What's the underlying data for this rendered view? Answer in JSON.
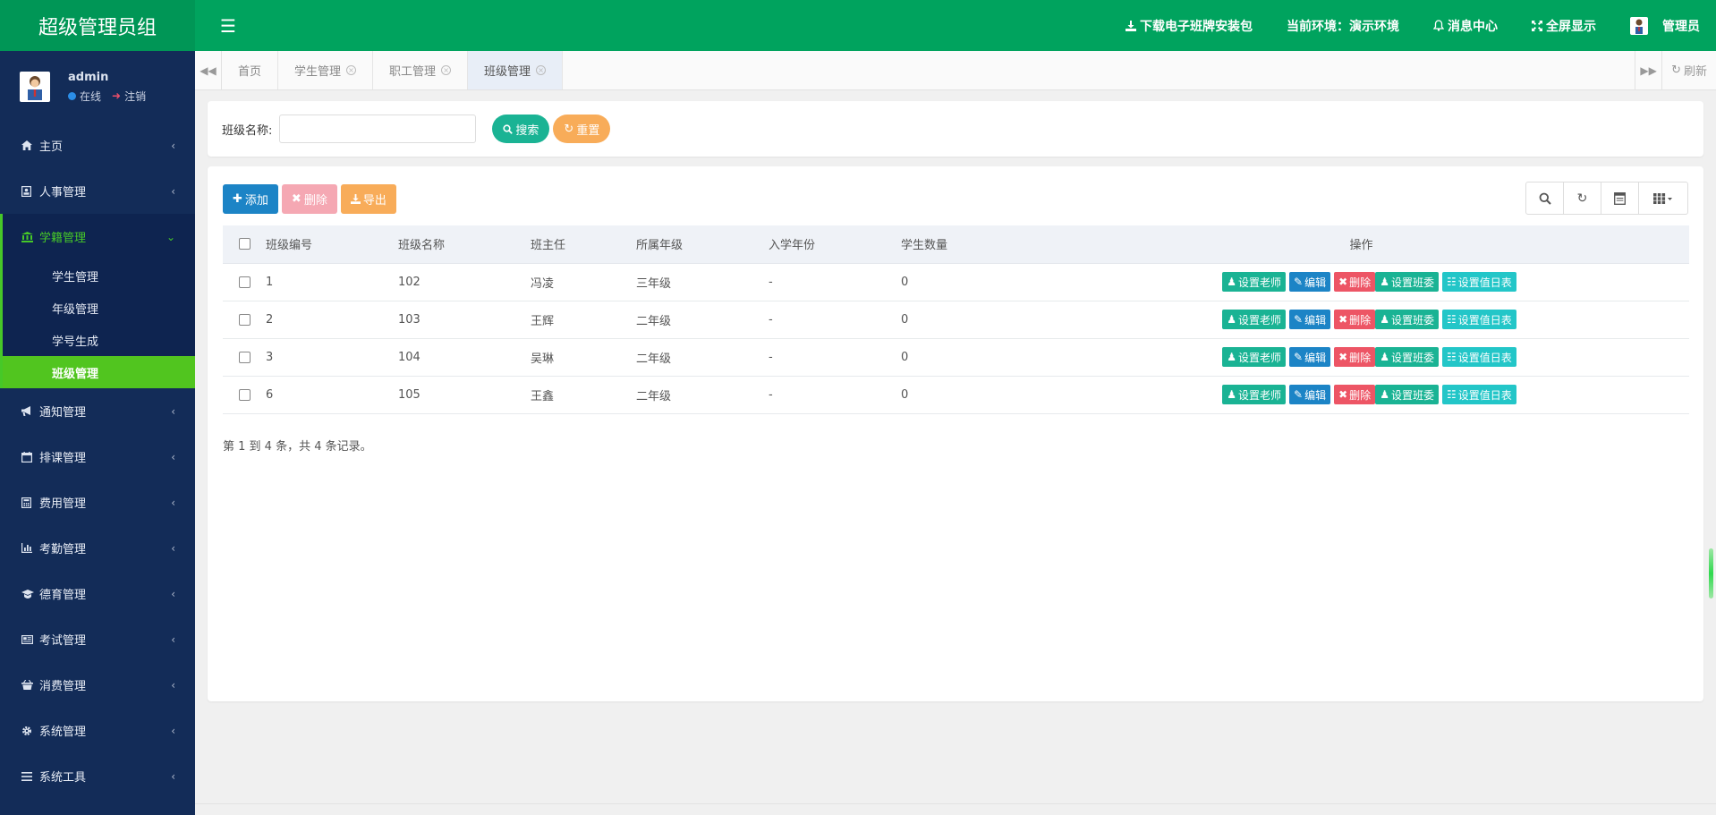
{
  "brand": {
    "title": "超级管理员组"
  },
  "topbar": {
    "download": "下载电子班牌安装包",
    "environment": "当前环境：演示环境",
    "messages": "消息中心",
    "fullscreen": "全屏显示",
    "admin": "管理员"
  },
  "user": {
    "name": "admin",
    "status": "在线",
    "logout": "注销"
  },
  "sidebar": {
    "items": [
      {
        "label": "主页",
        "icon": "home-icon"
      },
      {
        "label": "人事管理",
        "icon": "person-card-icon"
      },
      {
        "label": "学籍管理",
        "icon": "bank-icon",
        "active": true
      },
      {
        "label": "通知管理",
        "icon": "megaphone-icon"
      },
      {
        "label": "排课管理",
        "icon": "calendar-icon"
      },
      {
        "label": "费用管理",
        "icon": "calculator-icon"
      },
      {
        "label": "考勤管理",
        "icon": "bar-chart-icon"
      },
      {
        "label": "德育管理",
        "icon": "graduation-cap-icon"
      },
      {
        "label": "考试管理",
        "icon": "newspaper-icon"
      },
      {
        "label": "消费管理",
        "icon": "basket-icon"
      },
      {
        "label": "系统管理",
        "icon": "gear-icon"
      },
      {
        "label": "系统工具",
        "icon": "list-icon"
      }
    ],
    "submenu": [
      "学生管理",
      "年级管理",
      "学号生成",
      "班级管理"
    ]
  },
  "tabs": [
    {
      "label": "首页"
    },
    {
      "label": "学生管理"
    },
    {
      "label": "职工管理"
    },
    {
      "label": "班级管理",
      "active": true
    }
  ],
  "tabs_refresh": "刷新",
  "search": {
    "label": "班级名称:",
    "value": "",
    "placeholder": "",
    "search_btn": "搜索",
    "reset_btn": "重置"
  },
  "toolbar": {
    "add": "添加",
    "delete": "删除",
    "export": "导出"
  },
  "table": {
    "headers": [
      "班级编号",
      "班级名称",
      "班主任",
      "所属年级",
      "入学年份",
      "学生数量",
      "操作"
    ],
    "rows": [
      {
        "id": "1",
        "name": "102",
        "head": "冯凌",
        "grade": "三年级",
        "year": "-",
        "count": "0"
      },
      {
        "id": "2",
        "name": "103",
        "head": "王辉",
        "grade": "二年级",
        "year": "-",
        "count": "0"
      },
      {
        "id": "3",
        "name": "104",
        "head": "吴琳",
        "grade": "二年级",
        "year": "-",
        "count": "0"
      },
      {
        "id": "6",
        "name": "105",
        "head": "王鑫",
        "grade": "二年级",
        "year": "-",
        "count": "0"
      }
    ],
    "ops": {
      "teacher": "设置老师",
      "edit": "编辑",
      "delete": "删除",
      "committee": "设置班委",
      "duty": "设置值日表"
    },
    "summary": "第 1 到 4 条，共 4 条记录。"
  },
  "colors": {
    "top_green": "#00a35e",
    "sidebar_navy": "#132c58",
    "active_green": "#51c51f",
    "teal": "#1ab394",
    "blue": "#1c84c6",
    "red": "#ed5565",
    "orange": "#f8ac59",
    "cyan": "#23c6c8"
  }
}
